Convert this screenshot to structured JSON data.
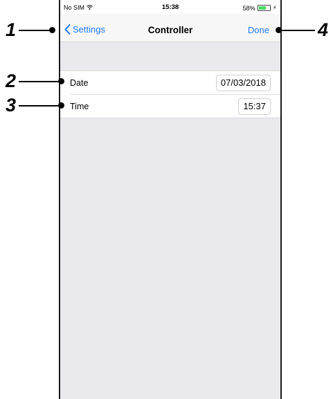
{
  "status_bar": {
    "carrier": "No SIM",
    "time": "15:38",
    "battery": "58%",
    "battery_level": 0.58
  },
  "nav": {
    "back_label": "Settings",
    "title": "Controller",
    "done_label": "Done"
  },
  "rows": [
    {
      "label": "Date",
      "value": "07/03/2018"
    },
    {
      "label": "Time",
      "value": "15:37"
    }
  ],
  "callouts": [
    "1",
    "2",
    "3",
    "4"
  ],
  "colors": {
    "accent": "#1e78ff",
    "background": "#e9e9ee",
    "battery": "#4cd964"
  }
}
